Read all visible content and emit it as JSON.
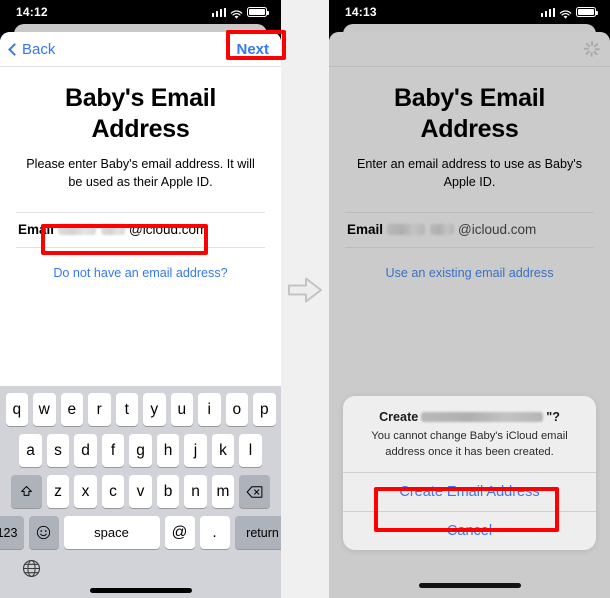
{
  "left_phone": {
    "status_bar": {
      "time": "14:12",
      "cellular_icon": "cellular-bars-icon",
      "wifi_icon": "wifi-icon",
      "battery_icon": "battery-icon"
    },
    "nav": {
      "back_label": "Back",
      "back_icon": "chevron-left-icon",
      "next_label": "Next"
    },
    "title": "Baby's Email Address",
    "subtitle": "Please enter Baby's email address. It will be used as their Apple ID.",
    "field": {
      "label": "Email",
      "value_redacted": true,
      "domain": "@icloud.com"
    },
    "link": "Do not have an email address?",
    "keyboard": {
      "row1": [
        "q",
        "w",
        "e",
        "r",
        "t",
        "y",
        "u",
        "i",
        "o",
        "p"
      ],
      "row2": [
        "a",
        "s",
        "d",
        "f",
        "g",
        "h",
        "j",
        "k",
        "l"
      ],
      "row3": [
        "z",
        "x",
        "c",
        "v",
        "b",
        "n",
        "m"
      ],
      "shift_icon": "shift-up-icon",
      "backspace_icon": "backspace-icon",
      "numbers_label": "123",
      "emoji_icon": "emoji-smiley-icon",
      "space_label": "space",
      "at_label": "@",
      "period_label": ".",
      "return_label": "return",
      "globe_icon": "globe-icon"
    }
  },
  "right_phone": {
    "status_bar": {
      "time": "14:13",
      "cellular_icon": "cellular-bars-icon",
      "wifi_icon": "wifi-icon",
      "battery_icon": "battery-icon"
    },
    "nav": {
      "spinner_icon": "loading-spinner-icon"
    },
    "title": "Baby's Email Address",
    "subtitle": "Enter an email address to use as Baby's Apple ID.",
    "field": {
      "label": "Email",
      "value_redacted": true,
      "domain": "@icloud.com"
    },
    "link": "Use an existing email address",
    "alert": {
      "title_prefix": "Create",
      "title_suffix": "\"?",
      "message": "You cannot change Baby's iCloud email address once it has been created.",
      "confirm_label": "Create Email Address",
      "cancel_label": "Cancel"
    }
  },
  "annotations": {
    "arrow_icon": "right-arrow-icon",
    "highlight_color": "#fe0000",
    "highlighted_elements": [
      "next-button",
      "email-field",
      "create-email-address-button"
    ]
  },
  "theme": {
    "accent_blue": "#3478f6",
    "background": "#f0f0f0",
    "keyboard_bg": "#d1d3d9",
    "dim_overlay": "#cbcbcb"
  }
}
